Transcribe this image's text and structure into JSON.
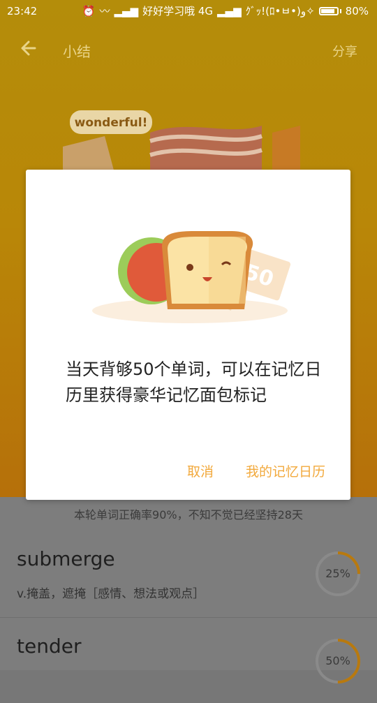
{
  "status_bar": {
    "time": "23:42",
    "carrier": "好好学习哦 4G",
    "extra": "ｸﾞｯ!(ﾛ•ㅂ•)و✧",
    "battery": "80%"
  },
  "header": {
    "title": "小结",
    "share_label": "分享",
    "badge": "wonderful!"
  },
  "dialog": {
    "badge_number": "50",
    "message": "当天背够50个单词，可以在记忆日历里获得豪华记忆面包标记",
    "cancel_label": "取消",
    "confirm_label": "我的记忆日历"
  },
  "summary": "本轮单词正确率90%，不知不觉已经坚持28天",
  "words": [
    {
      "word": "submerge",
      "meaning": "v.掩盖，遮掩［感情、想法或观点］",
      "progress": 25,
      "progress_label": "25%"
    },
    {
      "word": "tender",
      "progress": 50,
      "progress_label": "50%"
    }
  ],
  "colors": {
    "accent": "#f2a93c",
    "header_bg": "#f5b90f"
  }
}
